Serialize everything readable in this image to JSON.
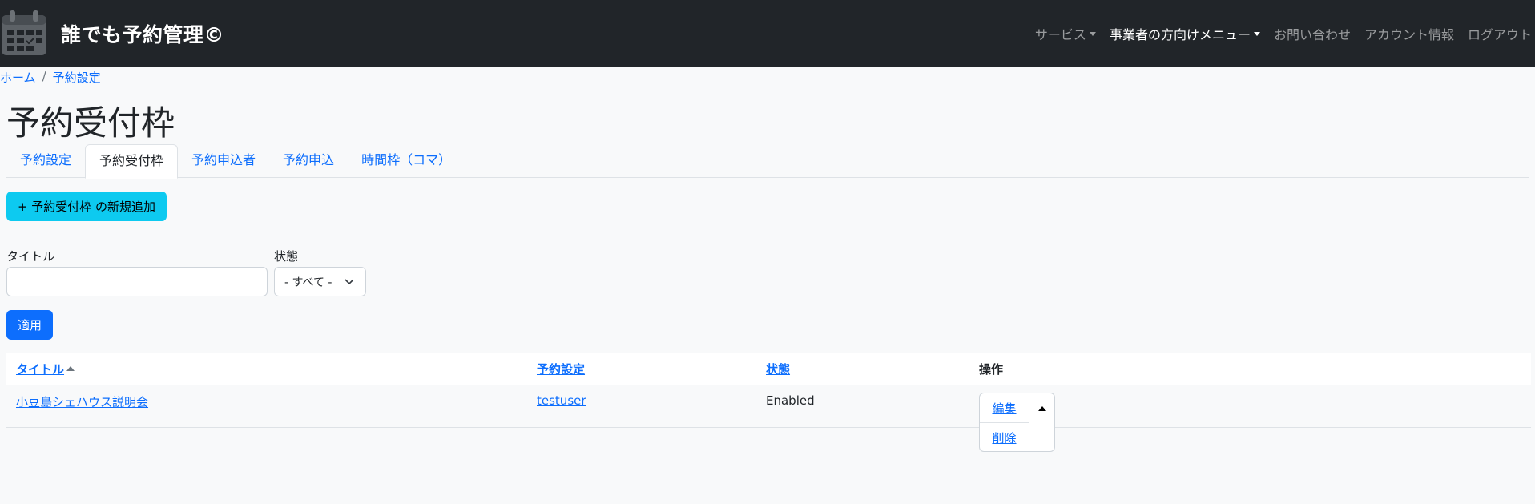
{
  "colors": {
    "navbar": "#212529",
    "link": "#0d6efd",
    "add_button": "#0dcaf0",
    "apply_button": "#0d6efd"
  },
  "navbar": {
    "brand_icon": "calendar-icon",
    "title": "誰でも予約管理©",
    "menu": [
      {
        "label": "サービス",
        "dropdown": true
      },
      {
        "label": "事業者の方向けメニュー",
        "dropdown": true
      },
      {
        "label": "お問い合わせ"
      },
      {
        "label": "アカウント情報"
      },
      {
        "label": "ログアウト"
      }
    ]
  },
  "breadcrumb": {
    "home": "ホーム",
    "separator": "/",
    "current": "予約設定"
  },
  "page_title": "予約受付枠",
  "tabs": [
    "予約設定",
    "予約受付枠",
    "予約申込者",
    "予約申込",
    "時間枠（コマ）"
  ],
  "add_button": "+ 予約受付枠 の新規追加",
  "filters": {
    "title_label": "タイトル",
    "title_value": "",
    "status_label": "状態",
    "status_value": "- すべて -"
  },
  "apply_button": "適用",
  "table": {
    "headers": {
      "title": "タイトル",
      "settings": "予約設定",
      "status": "状態",
      "ops": "操作"
    },
    "rows": [
      {
        "title": "小豆島シェハウス説明会",
        "settings": "testuser",
        "status": "Enabled",
        "edit": "編集",
        "delete": "削除"
      }
    ]
  }
}
